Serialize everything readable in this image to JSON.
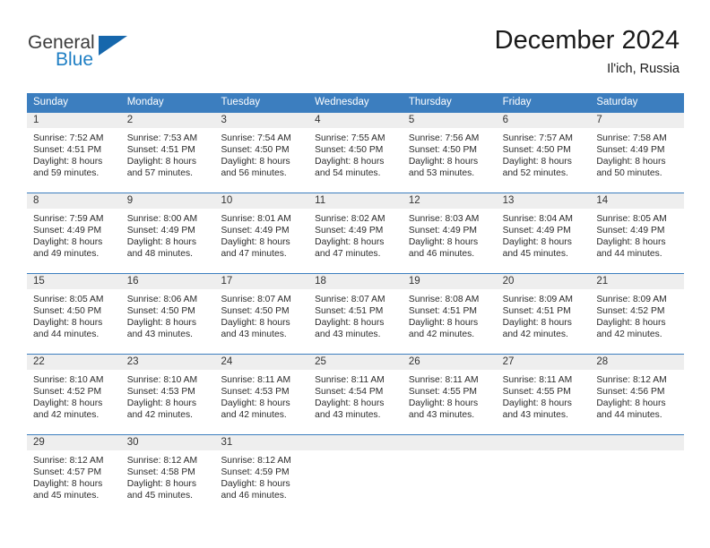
{
  "brand": {
    "name_part1": "General",
    "name_part2": "Blue",
    "logo_color": "#1667ac",
    "accent_color": "#1f7fc4"
  },
  "header": {
    "title": "December 2024",
    "subtitle": "Il'ich, Russia"
  },
  "theme": {
    "header_band": "#3c7ebf",
    "daynum_band": "#eeeeee",
    "text": "#2b2b2b"
  },
  "weekdays": [
    "Sunday",
    "Monday",
    "Tuesday",
    "Wednesday",
    "Thursday",
    "Friday",
    "Saturday"
  ],
  "weeks": [
    [
      {
        "day": "1",
        "sunrise": "Sunrise: 7:52 AM",
        "sunset": "Sunset: 4:51 PM",
        "daylight1": "Daylight: 8 hours",
        "daylight2": "and 59 minutes."
      },
      {
        "day": "2",
        "sunrise": "Sunrise: 7:53 AM",
        "sunset": "Sunset: 4:51 PM",
        "daylight1": "Daylight: 8 hours",
        "daylight2": "and 57 minutes."
      },
      {
        "day": "3",
        "sunrise": "Sunrise: 7:54 AM",
        "sunset": "Sunset: 4:50 PM",
        "daylight1": "Daylight: 8 hours",
        "daylight2": "and 56 minutes."
      },
      {
        "day": "4",
        "sunrise": "Sunrise: 7:55 AM",
        "sunset": "Sunset: 4:50 PM",
        "daylight1": "Daylight: 8 hours",
        "daylight2": "and 54 minutes."
      },
      {
        "day": "5",
        "sunrise": "Sunrise: 7:56 AM",
        "sunset": "Sunset: 4:50 PM",
        "daylight1": "Daylight: 8 hours",
        "daylight2": "and 53 minutes."
      },
      {
        "day": "6",
        "sunrise": "Sunrise: 7:57 AM",
        "sunset": "Sunset: 4:50 PM",
        "daylight1": "Daylight: 8 hours",
        "daylight2": "and 52 minutes."
      },
      {
        "day": "7",
        "sunrise": "Sunrise: 7:58 AM",
        "sunset": "Sunset: 4:49 PM",
        "daylight1": "Daylight: 8 hours",
        "daylight2": "and 50 minutes."
      }
    ],
    [
      {
        "day": "8",
        "sunrise": "Sunrise: 7:59 AM",
        "sunset": "Sunset: 4:49 PM",
        "daylight1": "Daylight: 8 hours",
        "daylight2": "and 49 minutes."
      },
      {
        "day": "9",
        "sunrise": "Sunrise: 8:00 AM",
        "sunset": "Sunset: 4:49 PM",
        "daylight1": "Daylight: 8 hours",
        "daylight2": "and 48 minutes."
      },
      {
        "day": "10",
        "sunrise": "Sunrise: 8:01 AM",
        "sunset": "Sunset: 4:49 PM",
        "daylight1": "Daylight: 8 hours",
        "daylight2": "and 47 minutes."
      },
      {
        "day": "11",
        "sunrise": "Sunrise: 8:02 AM",
        "sunset": "Sunset: 4:49 PM",
        "daylight1": "Daylight: 8 hours",
        "daylight2": "and 47 minutes."
      },
      {
        "day": "12",
        "sunrise": "Sunrise: 8:03 AM",
        "sunset": "Sunset: 4:49 PM",
        "daylight1": "Daylight: 8 hours",
        "daylight2": "and 46 minutes."
      },
      {
        "day": "13",
        "sunrise": "Sunrise: 8:04 AM",
        "sunset": "Sunset: 4:49 PM",
        "daylight1": "Daylight: 8 hours",
        "daylight2": "and 45 minutes."
      },
      {
        "day": "14",
        "sunrise": "Sunrise: 8:05 AM",
        "sunset": "Sunset: 4:49 PM",
        "daylight1": "Daylight: 8 hours",
        "daylight2": "and 44 minutes."
      }
    ],
    [
      {
        "day": "15",
        "sunrise": "Sunrise: 8:05 AM",
        "sunset": "Sunset: 4:50 PM",
        "daylight1": "Daylight: 8 hours",
        "daylight2": "and 44 minutes."
      },
      {
        "day": "16",
        "sunrise": "Sunrise: 8:06 AM",
        "sunset": "Sunset: 4:50 PM",
        "daylight1": "Daylight: 8 hours",
        "daylight2": "and 43 minutes."
      },
      {
        "day": "17",
        "sunrise": "Sunrise: 8:07 AM",
        "sunset": "Sunset: 4:50 PM",
        "daylight1": "Daylight: 8 hours",
        "daylight2": "and 43 minutes."
      },
      {
        "day": "18",
        "sunrise": "Sunrise: 8:07 AM",
        "sunset": "Sunset: 4:51 PM",
        "daylight1": "Daylight: 8 hours",
        "daylight2": "and 43 minutes."
      },
      {
        "day": "19",
        "sunrise": "Sunrise: 8:08 AM",
        "sunset": "Sunset: 4:51 PM",
        "daylight1": "Daylight: 8 hours",
        "daylight2": "and 42 minutes."
      },
      {
        "day": "20",
        "sunrise": "Sunrise: 8:09 AM",
        "sunset": "Sunset: 4:51 PM",
        "daylight1": "Daylight: 8 hours",
        "daylight2": "and 42 minutes."
      },
      {
        "day": "21",
        "sunrise": "Sunrise: 8:09 AM",
        "sunset": "Sunset: 4:52 PM",
        "daylight1": "Daylight: 8 hours",
        "daylight2": "and 42 minutes."
      }
    ],
    [
      {
        "day": "22",
        "sunrise": "Sunrise: 8:10 AM",
        "sunset": "Sunset: 4:52 PM",
        "daylight1": "Daylight: 8 hours",
        "daylight2": "and 42 minutes."
      },
      {
        "day": "23",
        "sunrise": "Sunrise: 8:10 AM",
        "sunset": "Sunset: 4:53 PM",
        "daylight1": "Daylight: 8 hours",
        "daylight2": "and 42 minutes."
      },
      {
        "day": "24",
        "sunrise": "Sunrise: 8:11 AM",
        "sunset": "Sunset: 4:53 PM",
        "daylight1": "Daylight: 8 hours",
        "daylight2": "and 42 minutes."
      },
      {
        "day": "25",
        "sunrise": "Sunrise: 8:11 AM",
        "sunset": "Sunset: 4:54 PM",
        "daylight1": "Daylight: 8 hours",
        "daylight2": "and 43 minutes."
      },
      {
        "day": "26",
        "sunrise": "Sunrise: 8:11 AM",
        "sunset": "Sunset: 4:55 PM",
        "daylight1": "Daylight: 8 hours",
        "daylight2": "and 43 minutes."
      },
      {
        "day": "27",
        "sunrise": "Sunrise: 8:11 AM",
        "sunset": "Sunset: 4:55 PM",
        "daylight1": "Daylight: 8 hours",
        "daylight2": "and 43 minutes."
      },
      {
        "day": "28",
        "sunrise": "Sunrise: 8:12 AM",
        "sunset": "Sunset: 4:56 PM",
        "daylight1": "Daylight: 8 hours",
        "daylight2": "and 44 minutes."
      }
    ],
    [
      {
        "day": "29",
        "sunrise": "Sunrise: 8:12 AM",
        "sunset": "Sunset: 4:57 PM",
        "daylight1": "Daylight: 8 hours",
        "daylight2": "and 45 minutes."
      },
      {
        "day": "30",
        "sunrise": "Sunrise: 8:12 AM",
        "sunset": "Sunset: 4:58 PM",
        "daylight1": "Daylight: 8 hours",
        "daylight2": "and 45 minutes."
      },
      {
        "day": "31",
        "sunrise": "Sunrise: 8:12 AM",
        "sunset": "Sunset: 4:59 PM",
        "daylight1": "Daylight: 8 hours",
        "daylight2": "and 46 minutes."
      },
      {
        "day": "",
        "sunrise": "",
        "sunset": "",
        "daylight1": "",
        "daylight2": ""
      },
      {
        "day": "",
        "sunrise": "",
        "sunset": "",
        "daylight1": "",
        "daylight2": ""
      },
      {
        "day": "",
        "sunrise": "",
        "sunset": "",
        "daylight1": "",
        "daylight2": ""
      },
      {
        "day": "",
        "sunrise": "",
        "sunset": "",
        "daylight1": "",
        "daylight2": ""
      }
    ]
  ]
}
